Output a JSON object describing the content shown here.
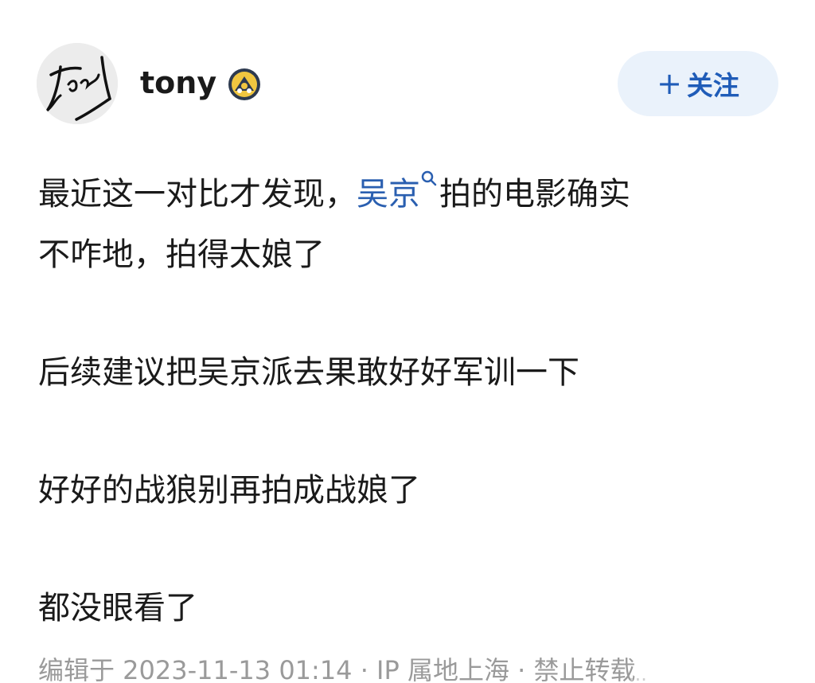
{
  "post": {
    "author": {
      "name": "tony",
      "avatar_icon": "handwritten-signature-avatar",
      "badge_icon": "verified-badge-icon"
    },
    "follow_button": {
      "plus": "+",
      "label": "关注"
    },
    "content": {
      "line1_prefix": "最近这一对比才发现，",
      "line1_link": "吴京",
      "line1_suffix": "拍的电影确实",
      "line2": "不咋地，拍得太娘了",
      "para2": "后续建议把吴京派去果敢好好军训一下",
      "para3": "好好的战狼别再拍成战娘了",
      "para4": "都没眼看了"
    },
    "meta": "编辑于 2023-11-13 01:14 · IP 属地上海 · 禁止转载",
    "watermark": "···"
  },
  "colors": {
    "link": "#2a5fb0",
    "follow_bg": "#eaf2fb",
    "follow_text": "#1f5cb8",
    "meta_text": "#9a9a9a"
  }
}
